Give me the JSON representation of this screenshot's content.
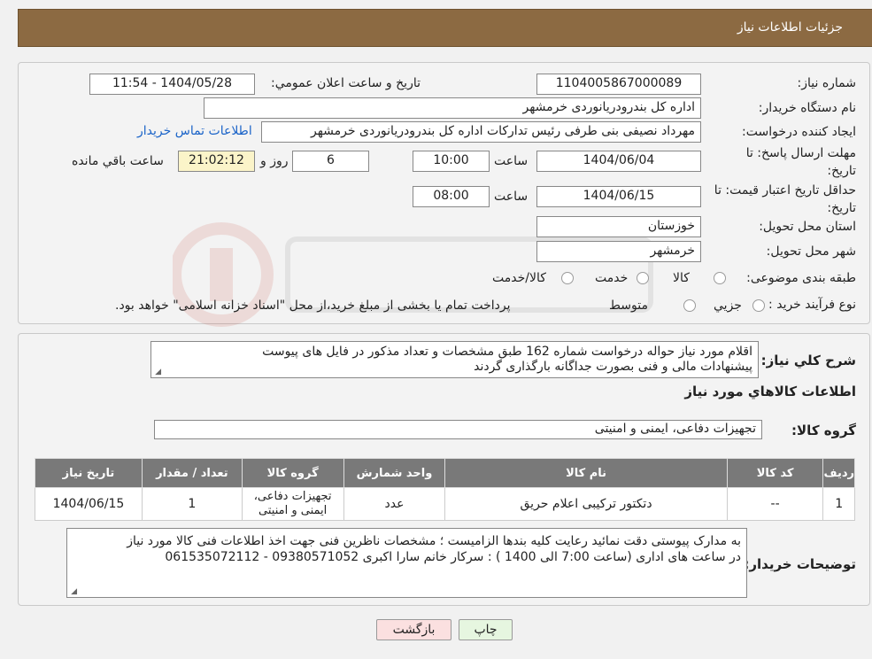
{
  "header": {
    "title": "جزئیات اطلاعات نیاز"
  },
  "form": {
    "need_number_label": "شماره نیاز:",
    "need_number": "1104005867000089",
    "announce_label": "تاریخ و ساعت اعلان عمومي:",
    "announce_value": "1404/05/28 - 11:54",
    "buyer_org_label": "نام دستگاه خريدار:",
    "buyer_org": "اداره کل بندرودريانوردی خرمشهر",
    "requester_label": "ايجاد کننده درخواست:",
    "requester": "مهرداد  نصيفی بنی طرفی رئيس تدارکات اداره کل بندرودريانوردی خرمشهر",
    "contact_link": "اطلاعات تماس خريدار",
    "reply_deadline_label": "مهلت ارسال پاسخ: تا تاريخ:",
    "reply_date": "1404/06/04",
    "time_label": "ساعت",
    "reply_time": "10:00",
    "days_value": "6",
    "days_label": "روز و",
    "remaining_time": "21:02:12",
    "remaining_label": "ساعت باقي مانده",
    "price_validity_label": "حداقل تاريخ اعتبار قيمت: تا تاريخ:",
    "validity_date": "1404/06/15",
    "validity_time": "08:00",
    "province_label": "استان محل تحويل:",
    "province": "خوزستان",
    "city_label": "شهر محل تحويل:",
    "city": "خرمشهر",
    "category_label": "طبقه بندی موضوعی:",
    "category_options": [
      "کالا",
      "خدمت",
      "کالا/خدمت"
    ],
    "process_label": "نوع فرآيند خريد :",
    "process_options": [
      "جزيي",
      "متوسط"
    ],
    "payment_note": "پرداخت تمام يا بخشی از مبلغ خريد،از محل \"اسناد خزانه اسلامی\" خواهد بود."
  },
  "summary": {
    "label": "شرح کلي نياز:",
    "text_line1": "اقلام مورد نیاز حواله درخواست شماره 162 طبق مشخصات و تعداد مذکور در فایل های پیوست",
    "text_line2": "پیشنهادات مالی و فنی بصورت جداگانه بارگذاری گردند"
  },
  "goods": {
    "section_title": "اطلاعات کالاهاي مورد نياز",
    "group_label": "گروه کالا:",
    "group_value": "تجهیزات دفاعی، ایمنی و امنیتی",
    "table": {
      "headers": [
        "رديف",
        "کد کالا",
        "نام کالا",
        "واحد شمارش",
        "گروه کالا",
        "تعداد / مقدار",
        "تاريخ نياز"
      ],
      "rows": [
        {
          "row": "1",
          "code": "--",
          "name": "دتکتور ترکیبی اعلام حریق",
          "unit": "عدد",
          "group_line1": "تجهیزات دفاعی،",
          "group_line2": "ایمنی و امنیتی",
          "qty": "1",
          "date": "1404/06/15"
        }
      ]
    }
  },
  "buyer_notes": {
    "label": "توضيحات خريدار:",
    "line1": "به مدارک پیوستی دقت نمائید رعایت کلیه بندها الزامیست  ؛ مشخصات ناظرین فنی جهت اخذ اطلاعات فنی کالا مورد نیاز",
    "line2": "در ساعت های اداری (ساعت 7:00 الی 1400 ) : سرکار خانم سارا اکبری 09380571052 - 061535072112"
  },
  "buttons": {
    "print": "چاپ",
    "back": "بازگشت"
  },
  "colors": {
    "header_bg": "#8c6a42",
    "table_header_bg": "#797979",
    "link": "#1a63c8",
    "back_button_bg": "#fbe0e0",
    "print_button_bg": "#e6f6e0"
  }
}
